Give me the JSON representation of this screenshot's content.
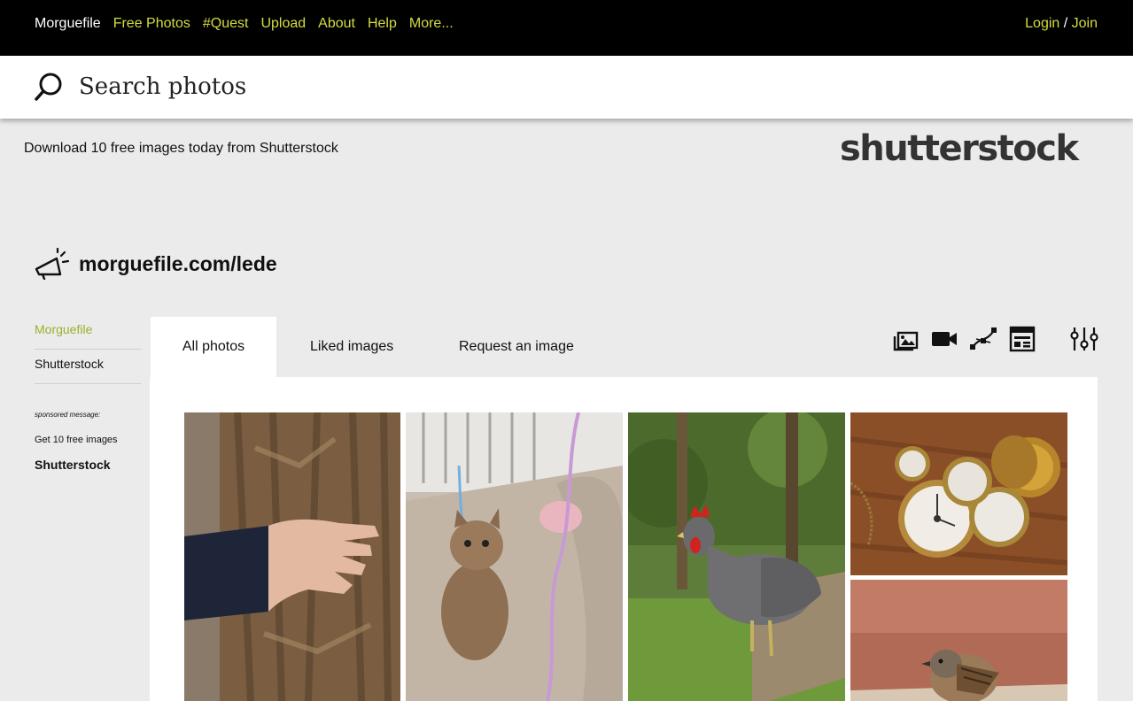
{
  "topnav": {
    "brand": "Morguefile",
    "links": [
      "Free Photos",
      "#Quest",
      "Upload",
      "About",
      "Help",
      "More..."
    ],
    "login": "Login",
    "separator": " / ",
    "join": "Join",
    "accent": "#d4dd3d"
  },
  "search": {
    "placeholder": "Search photos",
    "icon": "search-icon"
  },
  "promo": {
    "text": "Download 10 free images today from Shutterstock",
    "logo": "shutterstock"
  },
  "lede": {
    "icon": "megaphone-icon",
    "title": "morguefile.com/lede"
  },
  "sidebar": {
    "items": [
      {
        "label": "Morguefile",
        "active": true
      },
      {
        "label": "Shutterstock",
        "active": false
      }
    ],
    "sponsored_label": "sponsored message:",
    "get_text": "Get 10 free images",
    "sponsor": "Shutterstock",
    "active_color": "#9ab02b"
  },
  "tabs": [
    "All photos",
    "Liked images",
    "Request an image"
  ],
  "toolbar_icons": [
    "photos-icon",
    "video-icon",
    "vector-icon",
    "layout-icon",
    "filters-icon"
  ],
  "photos": [
    {
      "subject": "hand on tree bark"
    },
    {
      "subject": "cat on sofa with ribbons"
    },
    {
      "subject": "hen in garden"
    },
    {
      "subject": "pocket watches"
    },
    {
      "subject": "small bird"
    }
  ]
}
